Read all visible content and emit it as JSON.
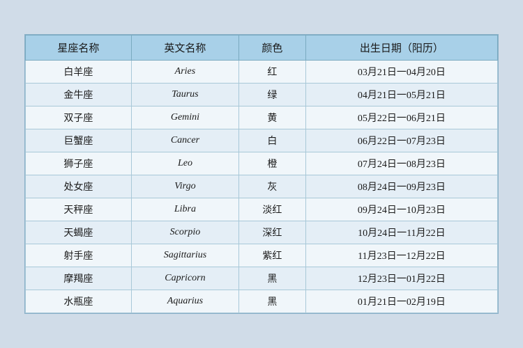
{
  "table": {
    "headers": [
      {
        "label": "星座名称",
        "key": "zh_name"
      },
      {
        "label": "英文名称",
        "key": "en_name"
      },
      {
        "label": "颜色",
        "key": "color"
      },
      {
        "label": "出生日期（阳历）",
        "key": "date_range"
      }
    ],
    "rows": [
      {
        "zh_name": "白羊座",
        "en_name": "Aries",
        "color": "红",
        "date_range": "03月21日一04月20日"
      },
      {
        "zh_name": "金牛座",
        "en_name": "Taurus",
        "color": "绿",
        "date_range": "04月21日一05月21日"
      },
      {
        "zh_name": "双子座",
        "en_name": "Gemini",
        "color": "黄",
        "date_range": "05月22日一06月21日"
      },
      {
        "zh_name": "巨蟹座",
        "en_name": "Cancer",
        "color": "白",
        "date_range": "06月22日一07月23日"
      },
      {
        "zh_name": "狮子座",
        "en_name": "Leo",
        "color": "橙",
        "date_range": "07月24日一08月23日"
      },
      {
        "zh_name": "处女座",
        "en_name": "Virgo",
        "color": "灰",
        "date_range": "08月24日一09月23日"
      },
      {
        "zh_name": "天秤座",
        "en_name": "Libra",
        "color": "淡红",
        "date_range": "09月24日一10月23日"
      },
      {
        "zh_name": "天蝎座",
        "en_name": "Scorpio",
        "color": "深红",
        "date_range": "10月24日一11月22日"
      },
      {
        "zh_name": "射手座",
        "en_name": "Sagittarius",
        "color": "紫红",
        "date_range": "11月23日一12月22日"
      },
      {
        "zh_name": "摩羯座",
        "en_name": "Capricorn",
        "color": "黑",
        "date_range": "12月23日一01月22日"
      },
      {
        "zh_name": "水瓶座",
        "en_name": "Aquarius",
        "color": "黑",
        "date_range": "01月21日一02月19日"
      }
    ]
  }
}
